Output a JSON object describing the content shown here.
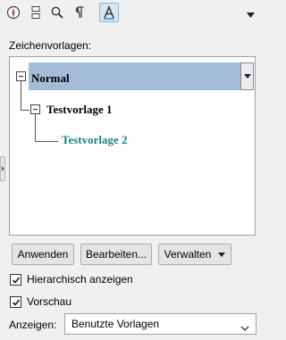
{
  "toolbar": {
    "icons": [
      "navigator-icon",
      "structure-icon",
      "find-icon",
      "paragraph-icon",
      "style-icon"
    ],
    "active": "style-icon"
  },
  "styles_label": "Zeichenvorlagen:",
  "tree": {
    "items": [
      {
        "label": "Normal",
        "level": 0,
        "expanded": true,
        "selected": true,
        "color": "#000000"
      },
      {
        "label": "Testvorlage 1",
        "level": 1,
        "expanded": true,
        "selected": false,
        "color": "#000000"
      },
      {
        "label": "Testvorlage 2",
        "level": 2,
        "expanded": false,
        "selected": false,
        "color": "#1a8080"
      }
    ]
  },
  "buttons": {
    "apply": "Anwenden",
    "edit": "Bearbeiten...",
    "manage": "Verwalten"
  },
  "options": {
    "hierarchical": {
      "label": "Hierarchisch anzeigen",
      "checked": true
    },
    "preview": {
      "label": "Vorschau",
      "checked": true
    }
  },
  "show": {
    "label": "Anzeigen:",
    "value": "Benutzte Vorlagen"
  },
  "colors": {
    "selection": "#a5bcd9",
    "child_style": "#1a8080",
    "active_tool": "#d7e6f5"
  }
}
